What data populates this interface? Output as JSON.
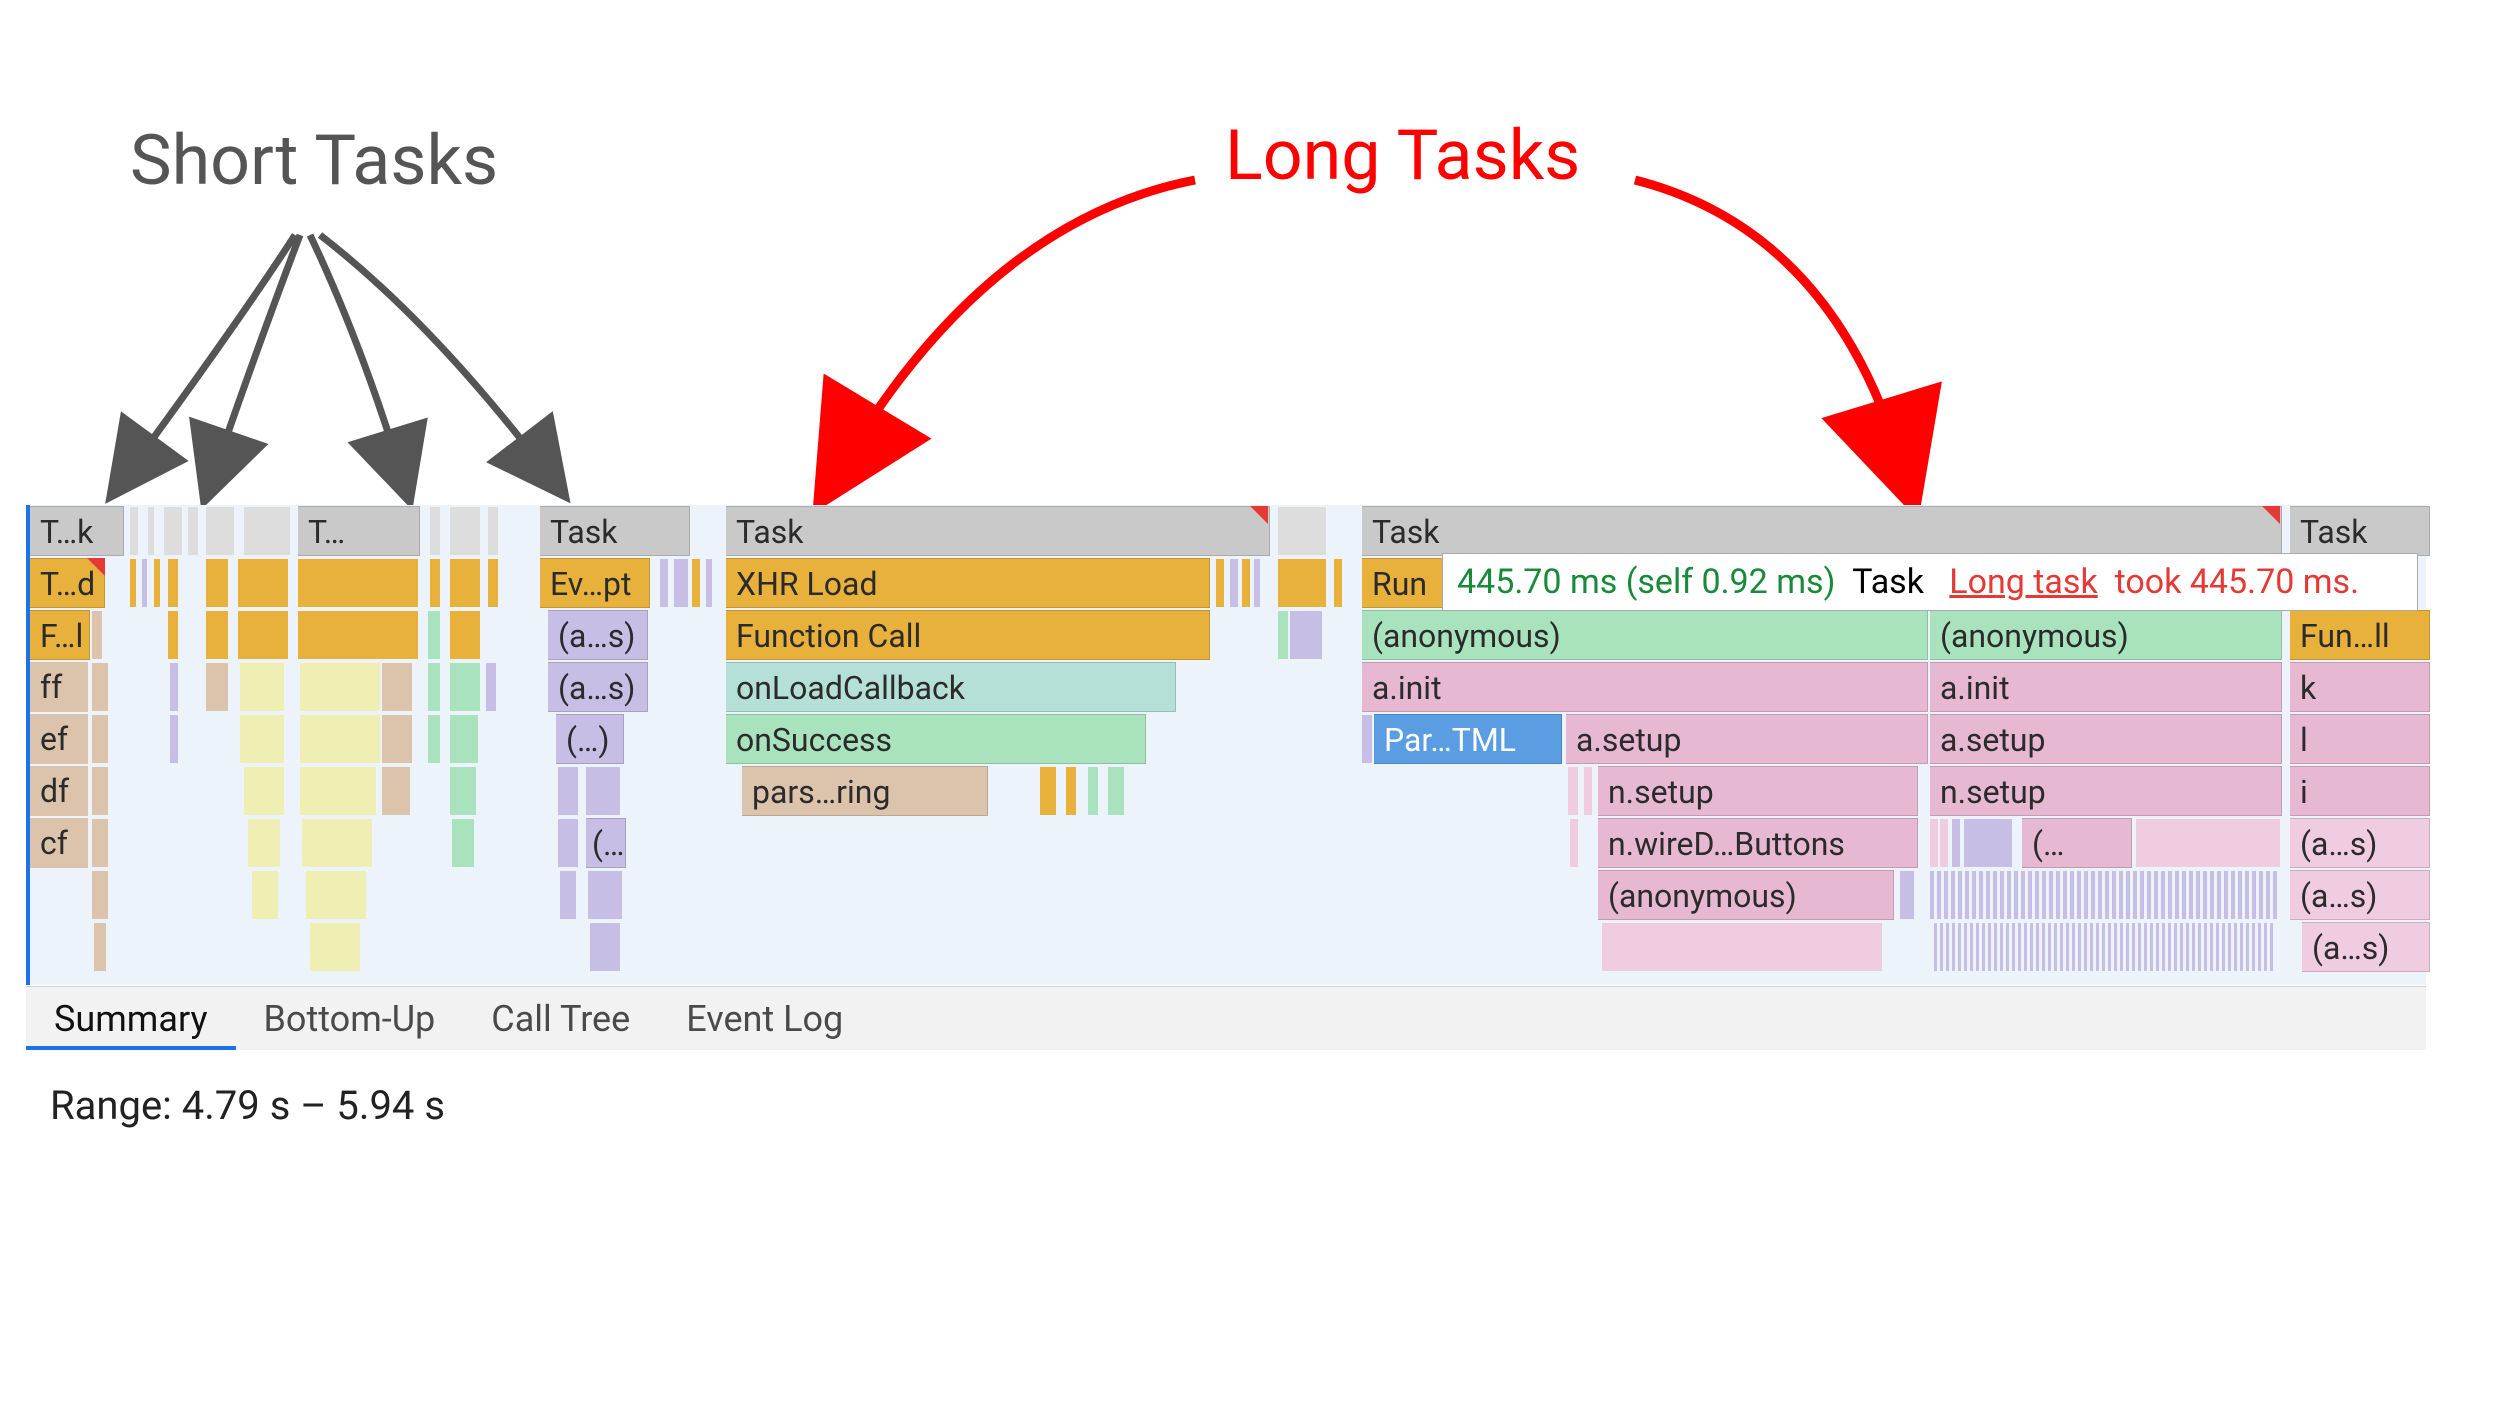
{
  "annotations": {
    "short": "Short Tasks",
    "long": "Long Tasks"
  },
  "flame": {
    "col1": {
      "r0": "T…k",
      "r0b": "T…",
      "r1": "T…d",
      "r2": "F…l",
      "r3": "ff",
      "r4": "ef",
      "r5": "df",
      "r6": "cf"
    },
    "col2": {
      "r0": "Task",
      "r1": "Ev…pt",
      "r2": "(a…s)",
      "r3": "(a…s)",
      "r4": "(…)",
      "r6": "(…"
    },
    "col3": {
      "r0": "Task",
      "r1": "XHR Load",
      "r2": "Function Call",
      "r3": "onLoadCallback",
      "r4": "onSuccess",
      "r5": "pars…ring"
    },
    "col4": {
      "r0": "Task",
      "r1": "Run",
      "r2a": "(anonymous)",
      "r2b": "(anonymous)",
      "r3a": "a.init",
      "r3b": "a.init",
      "r4a": "Par…TML",
      "r4b": "a.setup",
      "r4c": "a.setup",
      "r5a": "n.setup",
      "r5b": "n.setup",
      "r6a": "n.wireD…Buttons",
      "r6b": "(…",
      "r7": "(anonymous)"
    },
    "col5": {
      "r0": "Task",
      "r2": "Fun…ll",
      "r3": "k",
      "r4": "l",
      "r5": "i",
      "r6": "(a…s)",
      "r7": "(a…s)",
      "r8": "(a…s)"
    }
  },
  "tooltip": {
    "time": "445.70 ms (self 0.92 ms)",
    "label": "Task",
    "link": "Long task",
    "tail": "took 445.70 ms."
  },
  "tabs": {
    "summary": "Summary",
    "bottomup": "Bottom-Up",
    "calltree": "Call Tree",
    "eventlog": "Event Log"
  },
  "range": "Range: 4.79 s – 5.94 s"
}
